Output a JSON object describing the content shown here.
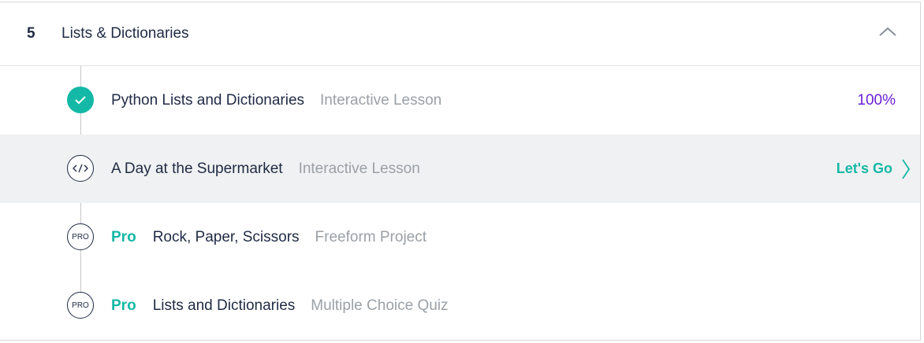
{
  "section": {
    "number": "5",
    "title": "Lists & Dictionaries",
    "collapse_icon": "chevron-up-icon"
  },
  "lessons": [
    {
      "title": "Python Lists and Dictionaries",
      "type": "Interactive Lesson",
      "status": "completed",
      "icon": "checkmark-icon",
      "progress": "100%"
    },
    {
      "title": "A Day at the Supermarket",
      "type": "Interactive Lesson",
      "status": "current",
      "icon": "code-icon",
      "action": "Let's Go"
    },
    {
      "pro_label": "Pro",
      "title": "Rock, Paper, Scissors",
      "type": "Freeform Project",
      "status": "locked",
      "icon": "pro-icon",
      "icon_text": "PRO"
    },
    {
      "pro_label": "Pro",
      "title": "Lists and Dictionaries",
      "type": "Multiple Choice Quiz",
      "status": "locked",
      "icon": "pro-icon",
      "icon_text": "PRO"
    }
  ],
  "colors": {
    "accent": "#14b8a6",
    "progress": "#6b21d6",
    "text": "#1f2a44",
    "muted": "#9aa0a6",
    "active_row_bg": "#f0f1f2"
  }
}
